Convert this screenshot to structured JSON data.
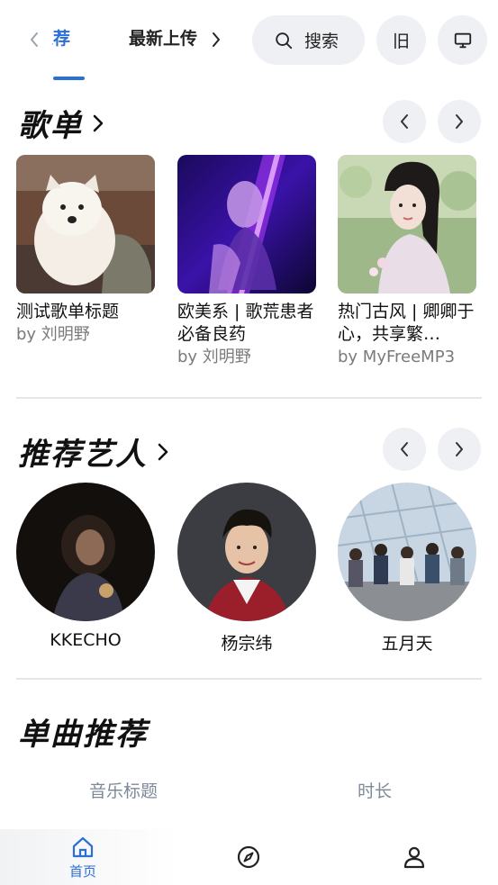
{
  "header": {
    "tabs": [
      {
        "label": "推荐",
        "visible_text": "推荐",
        "active": true
      },
      {
        "label": "最新上传",
        "active": false
      }
    ],
    "search_label": "搜索",
    "old_label": "旧"
  },
  "playlists": {
    "title": "歌单",
    "items": [
      {
        "name": "测试歌单标题",
        "by": "by 刘明野"
      },
      {
        "name": "欧美系 | 歌荒患者必备良药",
        "by": "by 刘明野"
      },
      {
        "name": "热门古风 | 卿卿于心，共享繁…",
        "by": "by MyFreeMP3"
      }
    ]
  },
  "artists": {
    "title": "推荐艺人",
    "items": [
      {
        "name": "KKECHO"
      },
      {
        "name": "杨宗纬"
      },
      {
        "name": "五月天"
      }
    ]
  },
  "songs": {
    "title": "单曲推荐",
    "columns": [
      "音乐标题",
      "时长"
    ]
  },
  "bottom_nav": {
    "items": [
      {
        "label": "首页",
        "icon": "home-icon",
        "active": true
      },
      {
        "label": "",
        "icon": "compass-icon",
        "active": false
      },
      {
        "label": "",
        "icon": "user-icon",
        "active": false
      }
    ]
  },
  "colors": {
    "accent": "#2c6fd6",
    "button_bg": "#eef0f3",
    "muted_text": "#7a7a7a"
  }
}
